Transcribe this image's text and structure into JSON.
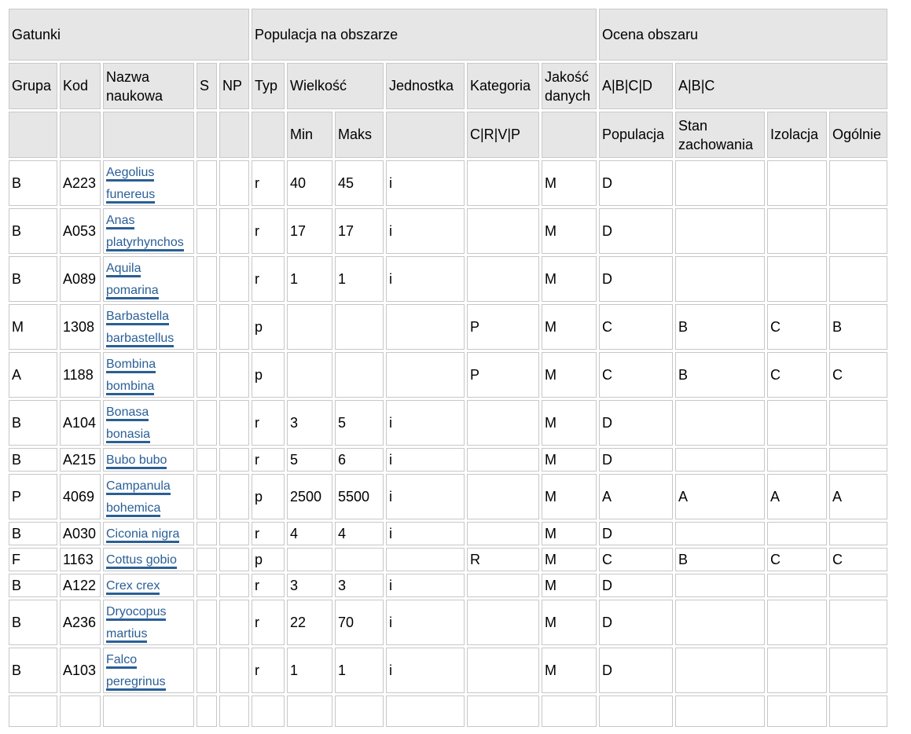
{
  "header": {
    "row1": {
      "gatunki": "Gatunki",
      "populacja": "Populacja na obszarze",
      "ocena": "Ocena obszaru"
    },
    "row2": {
      "grupa": "Grupa",
      "kod": "Kod",
      "nazwa": "Nazwa naukowa",
      "s": "S",
      "np": "NP",
      "typ": "Typ",
      "wielkosc": "Wielkość",
      "jednostka": "Jednostka",
      "kategoria": "Kategoria",
      "jakosc": "Jakość danych",
      "abcd": "A|B|C|D",
      "abc": "A|B|C"
    },
    "row3": {
      "min": "Min",
      "maks": "Maks",
      "crvp": "C|R|V|P",
      "populacja": "Populacja",
      "stan": "Stan zachowania",
      "izolacja": "Izolacja",
      "ogolnie": "Ogólnie"
    }
  },
  "rows": [
    {
      "grupa": "B",
      "kod": "A223",
      "nazwa": "Aegolius funereus",
      "s": "",
      "np": "",
      "typ": "r",
      "min": "40",
      "maks": "45",
      "jednostka": "i",
      "kategoria": "",
      "jakosc": "M",
      "populacja": "D",
      "stan": "",
      "izolacja": "",
      "ogolnie": ""
    },
    {
      "grupa": "B",
      "kod": "A053",
      "nazwa": "Anas platyrhynchos",
      "s": "",
      "np": "",
      "typ": "r",
      "min": "17",
      "maks": "17",
      "jednostka": "i",
      "kategoria": "",
      "jakosc": "M",
      "populacja": "D",
      "stan": "",
      "izolacja": "",
      "ogolnie": ""
    },
    {
      "grupa": "B",
      "kod": "A089",
      "nazwa": "Aquila pomarina",
      "s": "",
      "np": "",
      "typ": "r",
      "min": "1",
      "maks": "1",
      "jednostka": "i",
      "kategoria": "",
      "jakosc": "M",
      "populacja": "D",
      "stan": "",
      "izolacja": "",
      "ogolnie": ""
    },
    {
      "grupa": "M",
      "kod": "1308",
      "nazwa": "Barbastella barbastellus",
      "s": "",
      "np": "",
      "typ": "p",
      "min": "",
      "maks": "",
      "jednostka": "",
      "kategoria": "P",
      "jakosc": "M",
      "populacja": "C",
      "stan": "B",
      "izolacja": "C",
      "ogolnie": "B"
    },
    {
      "grupa": "A",
      "kod": "1188",
      "nazwa": "Bombina bombina",
      "s": "",
      "np": "",
      "typ": "p",
      "min": "",
      "maks": "",
      "jednostka": "",
      "kategoria": "P",
      "jakosc": "M",
      "populacja": "C",
      "stan": "B",
      "izolacja": "C",
      "ogolnie": "C"
    },
    {
      "grupa": "B",
      "kod": "A104",
      "nazwa": "Bonasa bonasia",
      "s": "",
      "np": "",
      "typ": "r",
      "min": "3",
      "maks": "5",
      "jednostka": "i",
      "kategoria": "",
      "jakosc": "M",
      "populacja": "D",
      "stan": "",
      "izolacja": "",
      "ogolnie": ""
    },
    {
      "grupa": "B",
      "kod": "A215",
      "nazwa": "Bubo bubo",
      "s": "",
      "np": "",
      "typ": "r",
      "min": "5",
      "maks": "6",
      "jednostka": "i",
      "kategoria": "",
      "jakosc": "M",
      "populacja": "D",
      "stan": "",
      "izolacja": "",
      "ogolnie": ""
    },
    {
      "grupa": "P",
      "kod": "4069",
      "nazwa": "Campanula bohemica",
      "s": "",
      "np": "",
      "typ": "p",
      "min": "2500",
      "maks": "5500",
      "jednostka": "i",
      "kategoria": "",
      "jakosc": "M",
      "populacja": "A",
      "stan": "A",
      "izolacja": "A",
      "ogolnie": "A"
    },
    {
      "grupa": "B",
      "kod": "A030",
      "nazwa": "Ciconia nigra",
      "s": "",
      "np": "",
      "typ": "r",
      "min": "4",
      "maks": "4",
      "jednostka": "i",
      "kategoria": "",
      "jakosc": "M",
      "populacja": "D",
      "stan": "",
      "izolacja": "",
      "ogolnie": ""
    },
    {
      "grupa": "F",
      "kod": "1163",
      "nazwa": "Cottus gobio",
      "s": "",
      "np": "",
      "typ": "p",
      "min": "",
      "maks": "",
      "jednostka": "",
      "kategoria": "R",
      "jakosc": "M",
      "populacja": "C",
      "stan": "B",
      "izolacja": "C",
      "ogolnie": "C"
    },
    {
      "grupa": "B",
      "kod": "A122",
      "nazwa": "Crex crex",
      "s": "",
      "np": "",
      "typ": "r",
      "min": "3",
      "maks": "3",
      "jednostka": "i",
      "kategoria": "",
      "jakosc": "M",
      "populacja": "D",
      "stan": "",
      "izolacja": "",
      "ogolnie": ""
    },
    {
      "grupa": "B",
      "kod": "A236",
      "nazwa": "Dryocopus martius",
      "s": "",
      "np": "",
      "typ": "r",
      "min": "22",
      "maks": "70",
      "jednostka": "i",
      "kategoria": "",
      "jakosc": "M",
      "populacja": "D",
      "stan": "",
      "izolacja": "",
      "ogolnie": ""
    },
    {
      "grupa": "B",
      "kod": "A103",
      "nazwa": "Falco peregrinus",
      "s": "",
      "np": "",
      "typ": "r",
      "min": "1",
      "maks": "1",
      "jednostka": "i",
      "kategoria": "",
      "jakosc": "M",
      "populacja": "D",
      "stan": "",
      "izolacja": "",
      "ogolnie": ""
    },
    {
      "grupa": "",
      "kod": "",
      "nazwa": "",
      "s": "",
      "np": "",
      "typ": "",
      "min": "",
      "maks": "",
      "jednostka": "",
      "kategoria": "",
      "jakosc": "",
      "populacja": "",
      "stan": "",
      "izolacja": "",
      "ogolnie": ""
    }
  ]
}
